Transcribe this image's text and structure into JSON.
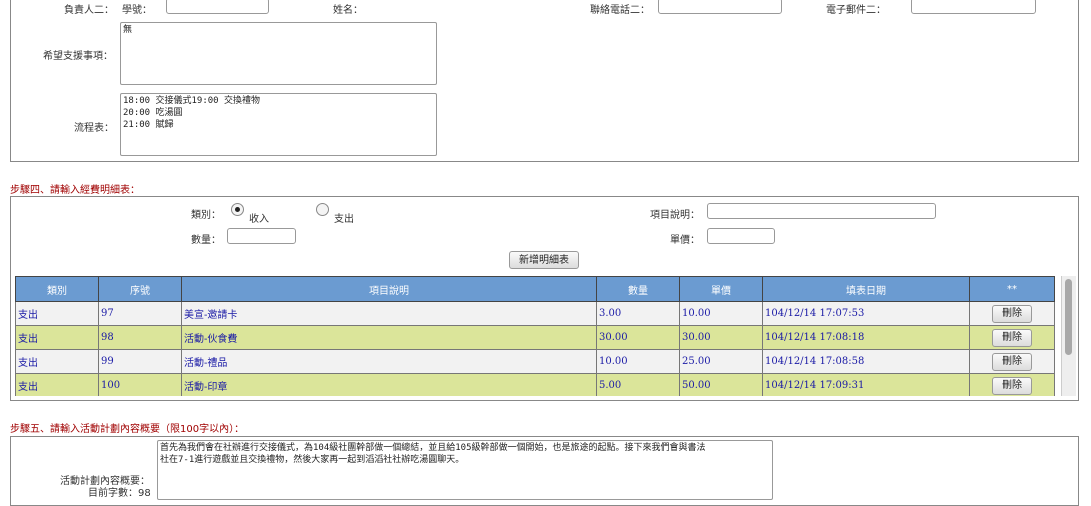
{
  "contact2": {
    "owner_label": "負責人二：",
    "student_id_label": "學號：",
    "student_id_value": "",
    "name_label": "姓名：",
    "phone_label": "聯絡電話二：",
    "phone_value": "",
    "email_label": "電子郵件二：",
    "email_value": ""
  },
  "support": {
    "label": "希望支援事項：",
    "value": "無"
  },
  "schedule": {
    "label": "流程表：",
    "value": "18:00 交接儀式19:00 交換禮物\n20:00 吃湯圓\n21:00 賦歸"
  },
  "step4": {
    "title": "步驟四、請輸入經費明細表：",
    "category_label": "類別：",
    "radio_income": "收入",
    "radio_expense": "支出",
    "selected": "收入",
    "item_desc_label": "項目說明：",
    "item_desc_value": "",
    "quantity_label": "數量：",
    "quantity_value": "",
    "unit_price_label": "單價：",
    "unit_price_value": "",
    "add_button": "新增明細表"
  },
  "table": {
    "headers": [
      "類別",
      "序號",
      "項目說明",
      "數量",
      "單價",
      "填表日期",
      "**"
    ],
    "rows": [
      {
        "type": "支出",
        "no": "97",
        "desc": "美宣-邀請卡",
        "qty": "3.00",
        "price": "10.00",
        "date": "104/12/14 17:07:53",
        "action": "刪除"
      },
      {
        "type": "支出",
        "no": "98",
        "desc": "活動-伙食費",
        "qty": "30.00",
        "price": "30.00",
        "date": "104/12/14 17:08:18",
        "action": "刪除"
      },
      {
        "type": "支出",
        "no": "99",
        "desc": "活動-禮品",
        "qty": "10.00",
        "price": "25.00",
        "date": "104/12/14 17:08:58",
        "action": "刪除"
      },
      {
        "type": "支出",
        "no": "100",
        "desc": "活動-印章",
        "qty": "5.00",
        "price": "50.00",
        "date": "104/12/14 17:09:31",
        "action": "刪除"
      }
    ]
  },
  "step5": {
    "title": "步驟五、請輸入活動計劃內容概要（限100字以內）：",
    "summary_label": "活動計劃內容概要：",
    "char_count_label": "目前字數：98",
    "summary_value": "首先為我們會在社辦進行交接儀式，為104級社團幹部做一個總結，並且給105級幹部做一個開始，也是旅途的起點。接下來我們會與書法\n社在7-1進行遊戲並且交換禮物，然後大家再一起到滔滔社社辦吃湯圓聊天。"
  }
}
